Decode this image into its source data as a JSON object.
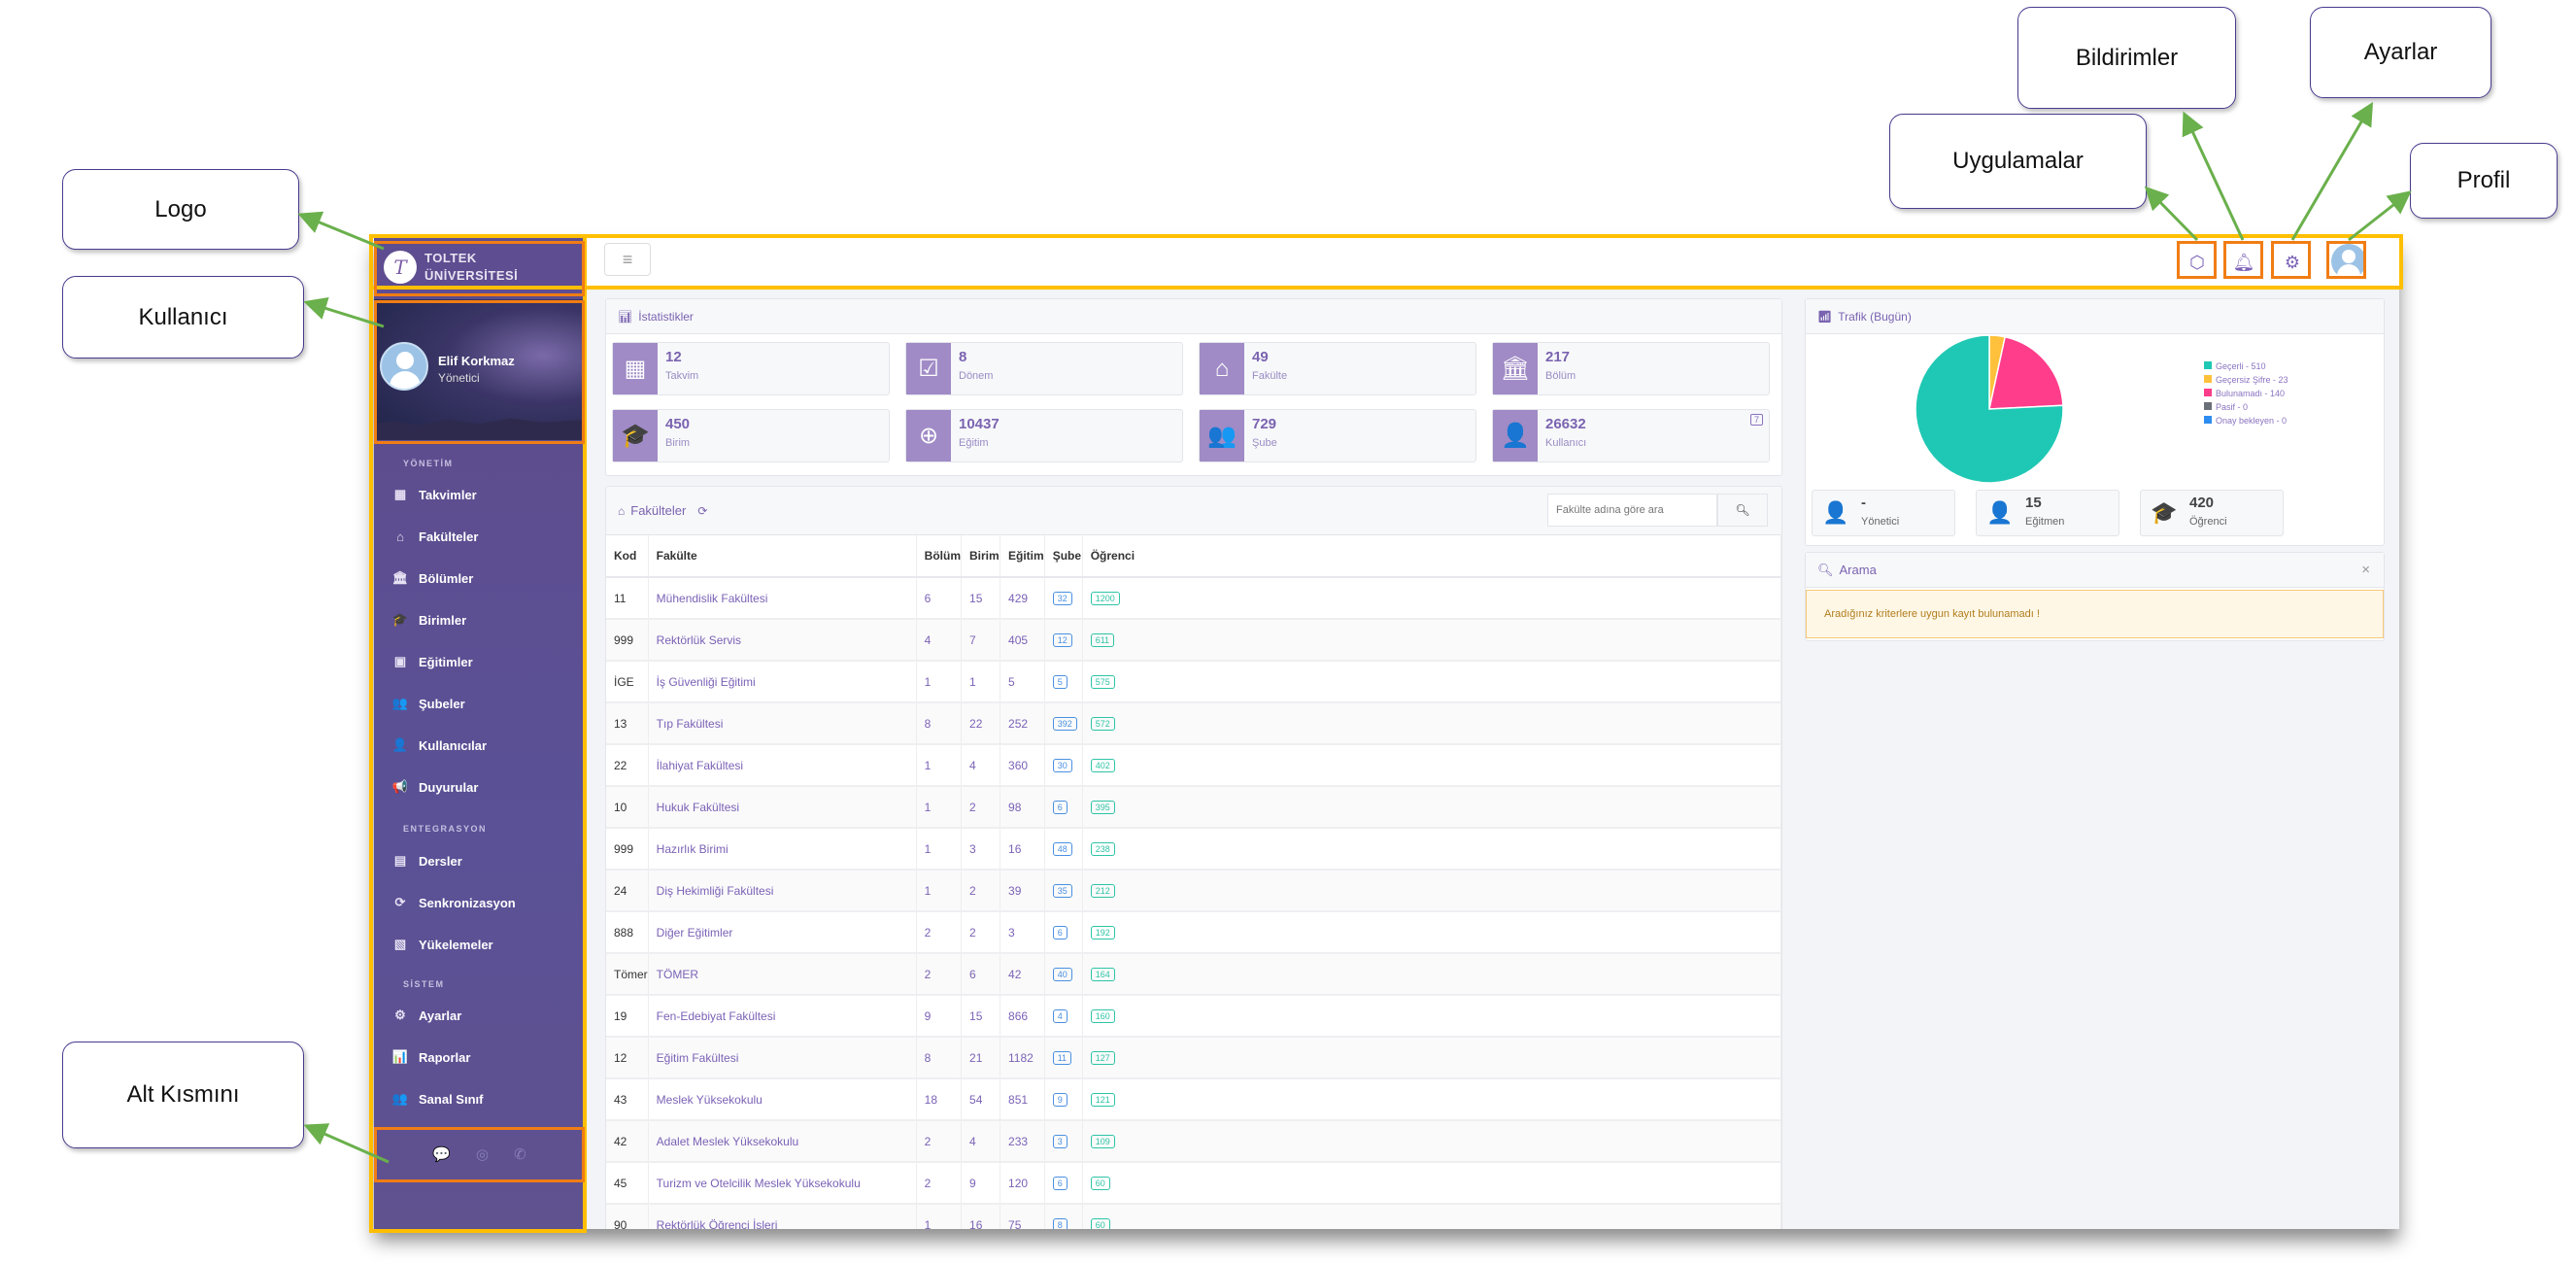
{
  "annotations": {
    "logo": "Logo",
    "user": "Kullanıcı",
    "footer": "Alt Kısmını",
    "apps": "Uygulamalar",
    "notifications": "Bildirimler",
    "settings": "Ayarlar",
    "profile": "Profil"
  },
  "brand": {
    "line1": "TOLTEK",
    "line2": "ÜNİVERSİTESİ",
    "mark": "T"
  },
  "user": {
    "name": "Elif Korkmaz",
    "role": "Yönetici"
  },
  "sidebar": {
    "sections": [
      {
        "title": "YÖNETİM",
        "items": [
          {
            "label": "Takvimler",
            "icon": "calendar-icon",
            "glyph": "▦"
          },
          {
            "label": "Fakülteler",
            "icon": "faculty-icon",
            "glyph": "⌂"
          },
          {
            "label": "Bölümler",
            "icon": "bank-icon",
            "glyph": "🏛"
          },
          {
            "label": "Birimler",
            "icon": "graduation-cap-icon",
            "glyph": "🎓"
          },
          {
            "label": "Eğitimler",
            "icon": "book-icon",
            "glyph": "▣"
          },
          {
            "label": "Şubeler",
            "icon": "users-icon",
            "glyph": "👥"
          },
          {
            "label": "Kullanıcılar",
            "icon": "user-icon",
            "glyph": "👤"
          },
          {
            "label": "Duyurular",
            "icon": "megaphone-icon",
            "glyph": "📢"
          }
        ]
      },
      {
        "title": "ENTEGRASYON",
        "items": [
          {
            "label": "Dersler",
            "icon": "list-icon",
            "glyph": "▤"
          },
          {
            "label": "Senkronizasyon",
            "icon": "sync-icon",
            "glyph": "⟳"
          },
          {
            "label": "Yükelemeler",
            "icon": "excel-file-icon",
            "glyph": "▧"
          }
        ]
      },
      {
        "title": "SİSTEM",
        "items": [
          {
            "label": "Ayarlar",
            "icon": "gear-icon",
            "glyph": "⚙"
          },
          {
            "label": "Raporlar",
            "icon": "chart-icon",
            "glyph": "📊"
          },
          {
            "label": "Sanal Sınıf",
            "icon": "users-icon",
            "glyph": "👥"
          }
        ]
      }
    ],
    "footer_icons": [
      "chat-icon",
      "support-icon",
      "phone-icon"
    ]
  },
  "topbar": {
    "icons": [
      "cube-icon",
      "bell-icon",
      "gear-icon",
      "profile-avatar"
    ]
  },
  "stats": {
    "title": "İstatistikler",
    "cards": [
      {
        "value": "12",
        "label": "Takvim",
        "icon": "calendar-icon",
        "glyph": "▦"
      },
      {
        "value": "8",
        "label": "Dönem",
        "icon": "calendar-check-icon",
        "glyph": "☑"
      },
      {
        "value": "49",
        "label": "Fakülte",
        "icon": "faculty-icon",
        "glyph": "⌂"
      },
      {
        "value": "217",
        "label": "Bölüm",
        "icon": "bank-icon",
        "glyph": "🏛"
      },
      {
        "value": "450",
        "label": "Birim",
        "icon": "graduation-cap-icon",
        "glyph": "🎓"
      },
      {
        "value": "10437",
        "label": "Eğitim",
        "icon": "passport-icon",
        "glyph": "⊕"
      },
      {
        "value": "729",
        "label": "Şube",
        "icon": "users-icon",
        "glyph": "👥"
      },
      {
        "value": "26632",
        "label": "Kullanıcı",
        "icon": "user-icon",
        "glyph": "👤",
        "badge": "7"
      }
    ]
  },
  "faculties": {
    "title": "Fakülteler",
    "search_placeholder": "Fakülte adına göre ara",
    "columns": [
      "Kod",
      "Fakülte",
      "Bölüm",
      "Birim",
      "Eğitim",
      "Şube",
      "Öğrenci"
    ],
    "rows": [
      [
        "11",
        "Mühendislik Fakültesi",
        "6",
        "15",
        "429",
        "32",
        "1200"
      ],
      [
        "999",
        "Rektörlük Servis",
        "4",
        "7",
        "405",
        "12",
        "611"
      ],
      [
        "İGE",
        "İş Güvenliği Eğitimi",
        "1",
        "1",
        "5",
        "5",
        "575"
      ],
      [
        "13",
        "Tıp Fakültesi",
        "8",
        "22",
        "252",
        "392",
        "572"
      ],
      [
        "22",
        "İlahiyat Fakültesi",
        "1",
        "4",
        "360",
        "30",
        "402"
      ],
      [
        "10",
        "Hukuk Fakültesi",
        "1",
        "2",
        "98",
        "6",
        "395"
      ],
      [
        "999",
        "Hazırlık Birimi",
        "1",
        "3",
        "16",
        "48",
        "238"
      ],
      [
        "24",
        "Diş Hekimliği Fakültesi",
        "1",
        "2",
        "39",
        "35",
        "212"
      ],
      [
        "888",
        "Diğer Eğitimler",
        "2",
        "2",
        "3",
        "6",
        "192"
      ],
      [
        "Tömer",
        "TÖMER",
        "2",
        "6",
        "42",
        "40",
        "164"
      ],
      [
        "19",
        "Fen-Edebiyat Fakültesi",
        "9",
        "15",
        "866",
        "4",
        "160"
      ],
      [
        "12",
        "Eğitim Fakültesi",
        "8",
        "21",
        "1182",
        "11",
        "127"
      ],
      [
        "43",
        "Meslek Yüksekokulu",
        "18",
        "54",
        "851",
        "9",
        "121"
      ],
      [
        "42",
        "Adalet Meslek Yüksekokulu",
        "2",
        "4",
        "233",
        "3",
        "109"
      ],
      [
        "45",
        "Turizm ve Otelcilik Meslek Yüksekokulu",
        "2",
        "9",
        "120",
        "6",
        "60"
      ],
      [
        "90",
        "Rektörlük Öğrenci İşleri",
        "1",
        "16",
        "75",
        "8",
        "60"
      ]
    ]
  },
  "traffic": {
    "title": "Trafik (Bugün)",
    "chart_data": {
      "type": "pie",
      "slices": [
        {
          "label": "Geçerli - 510",
          "value": 510,
          "color": "#1fc8b4"
        },
        {
          "label": "Geçersiz Şifre - 23",
          "value": 23,
          "color": "#ffc13b"
        },
        {
          "label": "Bulunamadı - 140",
          "value": 140,
          "color": "#ff3d8b"
        },
        {
          "label": "Pasif - 0",
          "value": 0,
          "color": "#6b6f78"
        },
        {
          "label": "Onay bekleyen - 0",
          "value": 0,
          "color": "#2d8cf0"
        }
      ],
      "order_drawn": [
        "Geçersiz Şifre - 23",
        "Bulunamadı - 140",
        "Geçerli - 510"
      ]
    },
    "summary": [
      {
        "value": "-",
        "label": "Yönetici",
        "icon": "user-gear-icon",
        "glyph": "👤"
      },
      {
        "value": "15",
        "label": "Eğitmen",
        "icon": "user-edit-icon",
        "glyph": "👤"
      },
      {
        "value": "420",
        "label": "Öğrenci",
        "icon": "student-icon",
        "glyph": "🎓"
      }
    ]
  },
  "search": {
    "title": "Arama",
    "close": "×",
    "message": "Aradığınız kriterlere uygun kayıt bulunamadı !"
  }
}
